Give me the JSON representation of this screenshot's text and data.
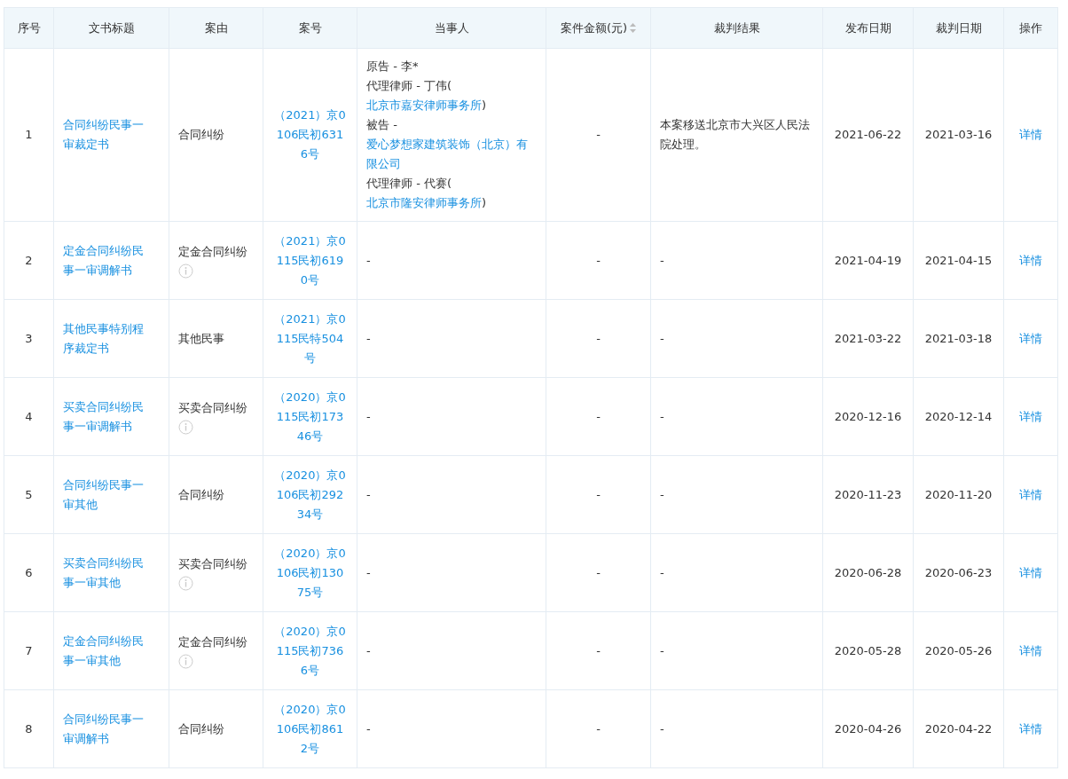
{
  "table": {
    "columns": [
      {
        "label": "序号"
      },
      {
        "label": "文书标题"
      },
      {
        "label": "案由"
      },
      {
        "label": "案号"
      },
      {
        "label": "当事人"
      },
      {
        "label": "案件金额(元)",
        "sortable": true
      },
      {
        "label": "裁判结果"
      },
      {
        "label": "发布日期"
      },
      {
        "label": "裁判日期"
      },
      {
        "label": "操作"
      }
    ],
    "rows": [
      {
        "index": "1",
        "title": "合同纠纷民事一审裁定书",
        "cause": "合同纠纷",
        "cause_info": false,
        "case_no": "（2021）京0106民初6316号",
        "parties": [
          [
            {
              "text": "原告 - 李*"
            }
          ],
          [
            {
              "text": "代理律师 - 丁伟( "
            },
            {
              "text": "北京市嘉安律师事务所",
              "kind": "link"
            },
            {
              "text": ")"
            }
          ],
          [
            {
              "text": "被告 - "
            },
            {
              "text": "爱心梦想家建筑装饰（北京）有限公司",
              "kind": "link"
            }
          ],
          [
            {
              "text": "代理律师 - 代赛( "
            },
            {
              "text": "北京市隆安律师事务所",
              "kind": "link"
            },
            {
              "text": ")"
            }
          ]
        ],
        "amount": "-",
        "result": "本案移送北京市大兴区人民法院处理。",
        "published": "2021-06-22",
        "judged": "2021-03-16",
        "action": "详情"
      },
      {
        "index": "2",
        "title": "定金合同纠纷民事一审调解书",
        "cause": "定金合同纠纷",
        "cause_info": true,
        "case_no": "（2021）京0115民初6190号",
        "parties": [
          [
            {
              "text": "-"
            }
          ]
        ],
        "amount": "-",
        "result": "-",
        "published": "2021-04-19",
        "judged": "2021-04-15",
        "action": "详情"
      },
      {
        "index": "3",
        "title": "其他民事特别程序裁定书",
        "cause": "其他民事",
        "cause_info": false,
        "case_no": "（2021）京0115民特504号",
        "parties": [
          [
            {
              "text": "-"
            }
          ]
        ],
        "amount": "-",
        "result": "-",
        "published": "2021-03-22",
        "judged": "2021-03-18",
        "action": "详情"
      },
      {
        "index": "4",
        "title": "买卖合同纠纷民事一审调解书",
        "cause": "买卖合同纠纷",
        "cause_info": true,
        "case_no": "（2020）京0115民初17346号",
        "parties": [
          [
            {
              "text": "-"
            }
          ]
        ],
        "amount": "-",
        "result": "-",
        "published": "2020-12-16",
        "judged": "2020-12-14",
        "action": "详情"
      },
      {
        "index": "5",
        "title": "合同纠纷民事一审其他",
        "cause": "合同纠纷",
        "cause_info": false,
        "case_no": "（2020）京0106民初29234号",
        "parties": [
          [
            {
              "text": "-"
            }
          ]
        ],
        "amount": "-",
        "result": "-",
        "published": "2020-11-23",
        "judged": "2020-11-20",
        "action": "详情"
      },
      {
        "index": "6",
        "title": "买卖合同纠纷民事一审其他",
        "cause": "买卖合同纠纷",
        "cause_info": true,
        "case_no": "（2020）京0106民初13075号",
        "parties": [
          [
            {
              "text": "-"
            }
          ]
        ],
        "amount": "-",
        "result": "-",
        "published": "2020-06-28",
        "judged": "2020-06-23",
        "action": "详情"
      },
      {
        "index": "7",
        "title": "定金合同纠纷民事一审其他",
        "cause": "定金合同纠纷",
        "cause_info": true,
        "case_no": "（2020）京0115民初7366号",
        "parties": [
          [
            {
              "text": "-"
            }
          ]
        ],
        "amount": "-",
        "result": "-",
        "published": "2020-05-28",
        "judged": "2020-05-26",
        "action": "详情"
      },
      {
        "index": "8",
        "title": "合同纠纷民事一审调解书",
        "cause": "合同纠纷",
        "cause_info": false,
        "case_no": "（2020）京0106民初8612号",
        "parties": [
          [
            {
              "text": "-"
            }
          ]
        ],
        "amount": "-",
        "result": "-",
        "published": "2020-04-26",
        "judged": "2020-04-22",
        "action": "详情"
      }
    ]
  }
}
